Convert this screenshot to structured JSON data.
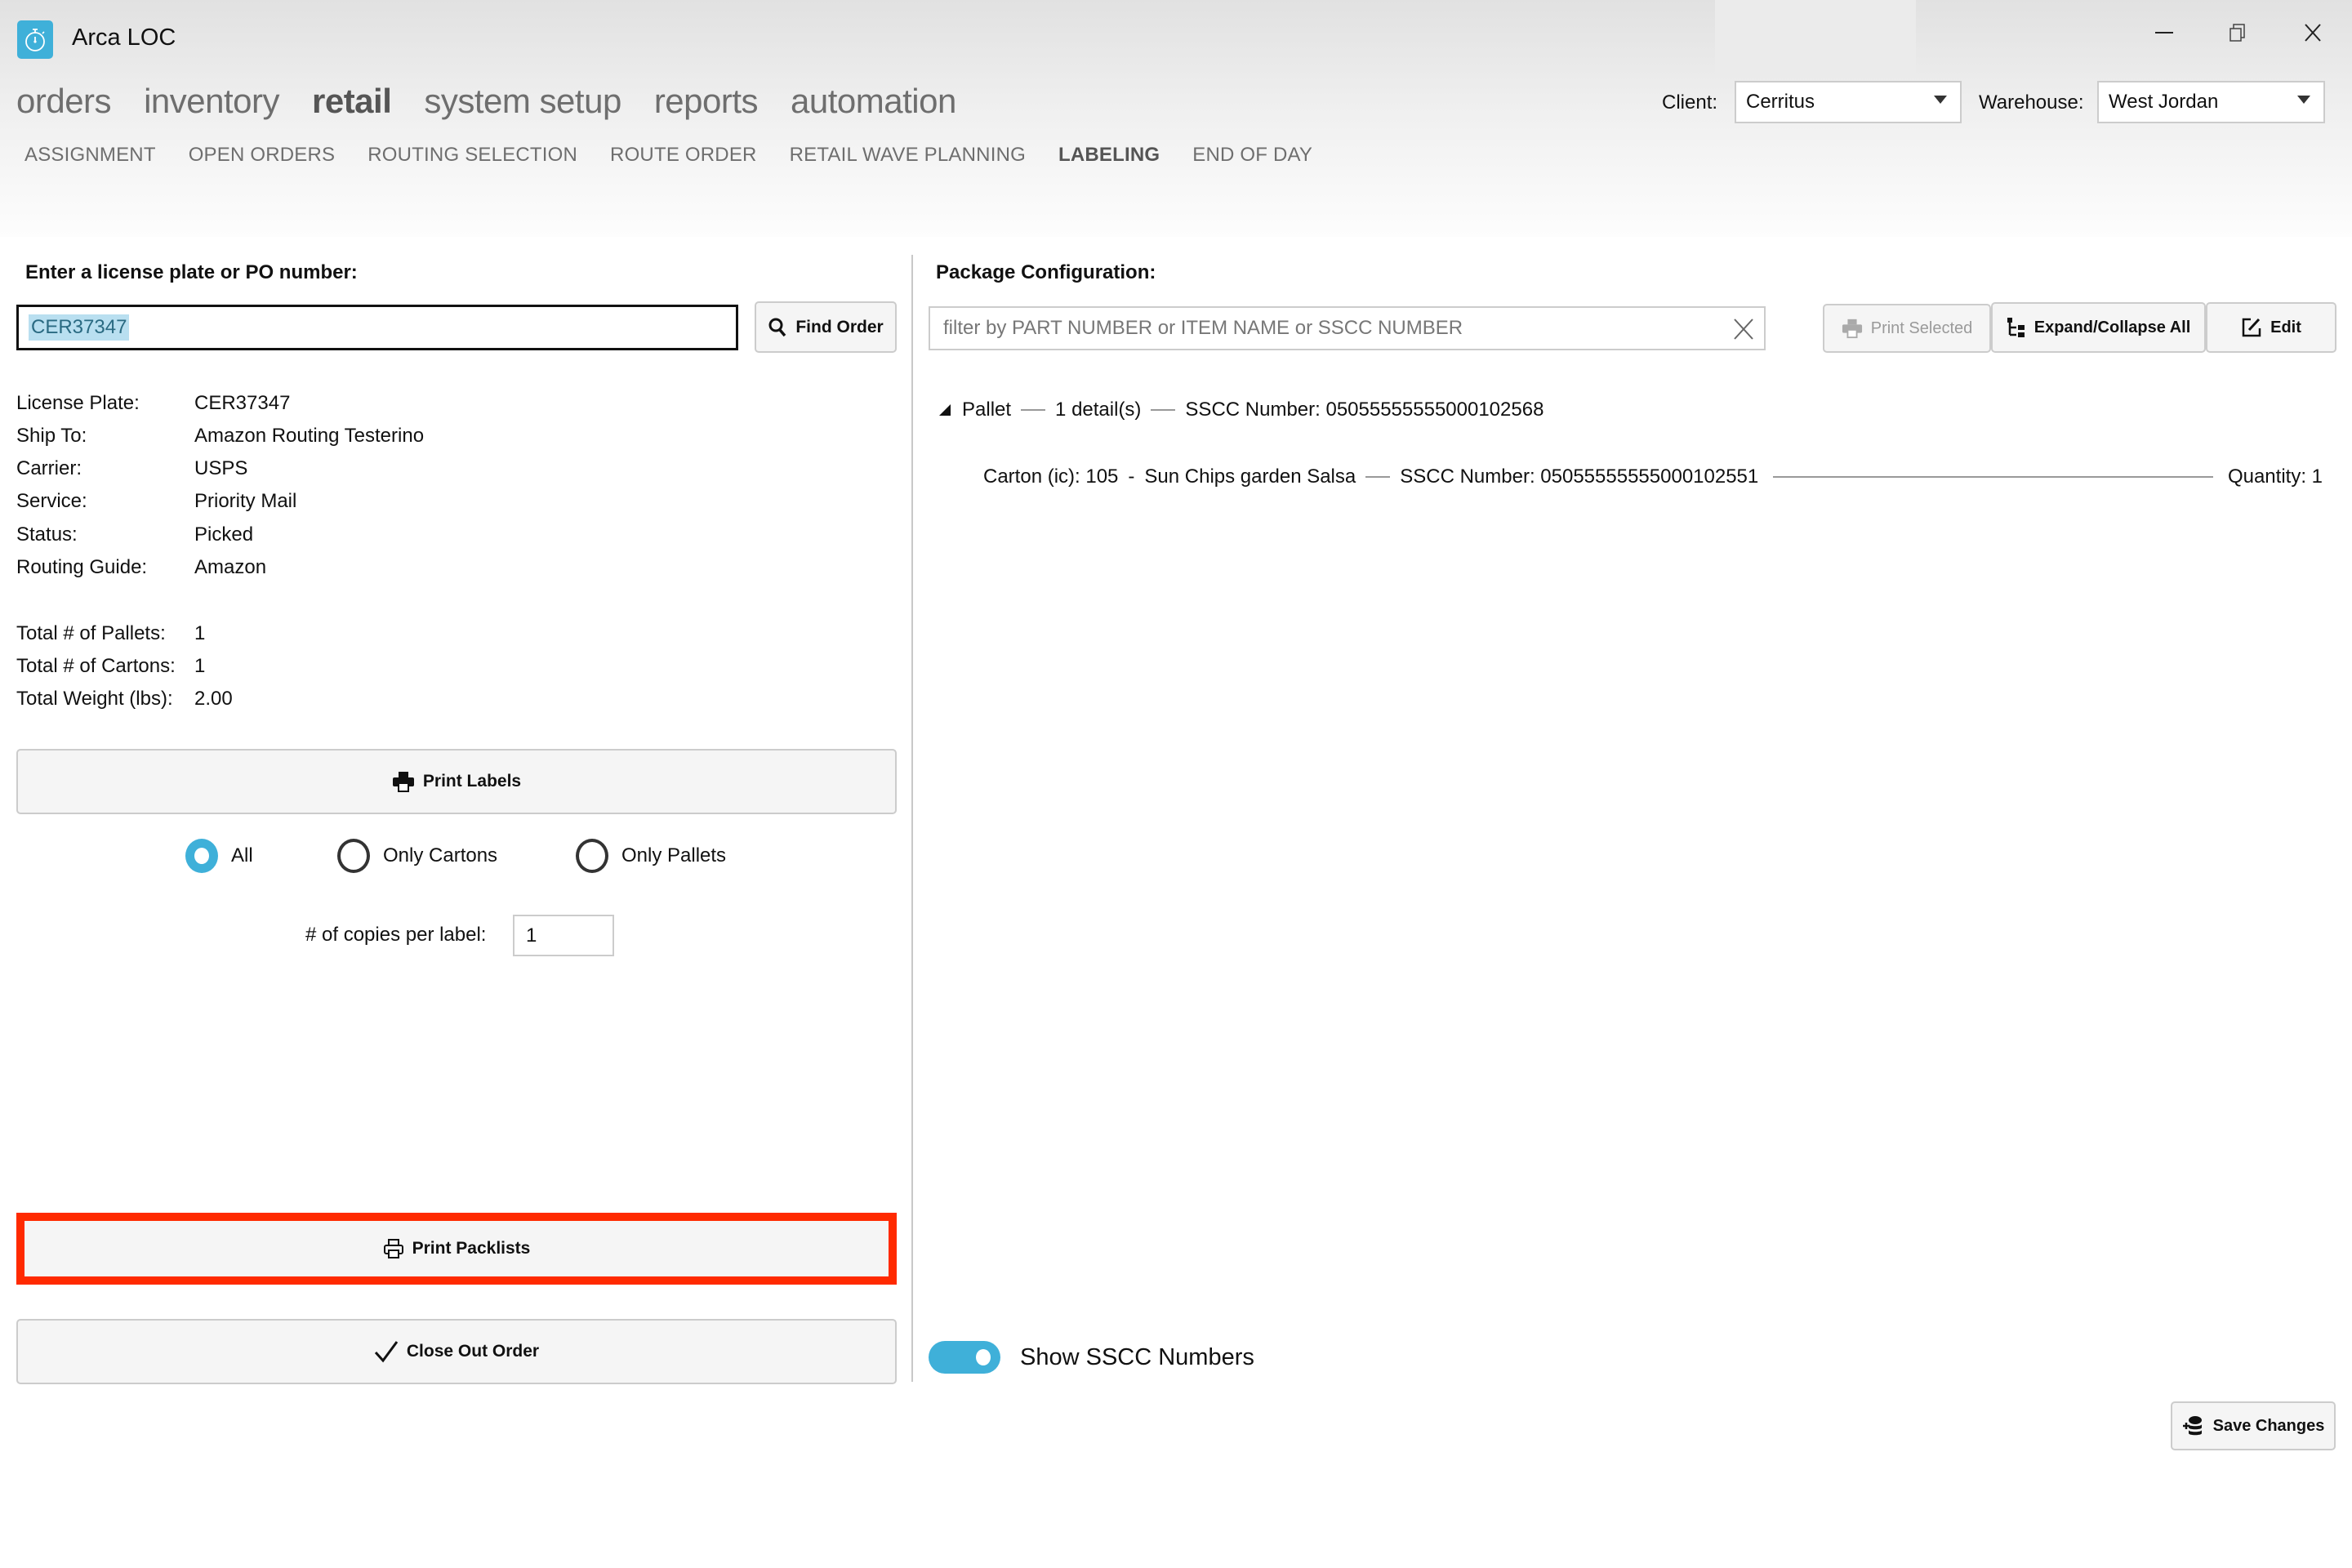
{
  "window": {
    "app_title": "Arca LOC",
    "icon": "stopwatch-icon",
    "controls": [
      "minimize-icon",
      "restore-icon",
      "close-icon"
    ]
  },
  "main_nav": {
    "items": [
      {
        "label": "orders",
        "active": false
      },
      {
        "label": "inventory",
        "active": false
      },
      {
        "label": "retail",
        "active": true
      },
      {
        "label": "system setup",
        "active": false
      },
      {
        "label": "reports",
        "active": false
      },
      {
        "label": "automation",
        "active": false
      }
    ]
  },
  "sub_nav": {
    "items": [
      {
        "label": "ASSIGNMENT",
        "active": false
      },
      {
        "label": "OPEN ORDERS",
        "active": false
      },
      {
        "label": "ROUTING SELECTION",
        "active": false
      },
      {
        "label": "ROUTE ORDER",
        "active": false
      },
      {
        "label": "RETAIL WAVE PLANNING",
        "active": false
      },
      {
        "label": "LABELING",
        "active": true
      },
      {
        "label": "END OF DAY",
        "active": false
      }
    ]
  },
  "filters": {
    "client_label": "Client:",
    "client_value": "Cerritus",
    "warehouse_label": "Warehouse:",
    "warehouse_value": "West Jordan"
  },
  "left": {
    "prompt": "Enter a license plate or PO number:",
    "search_value": "CER37347",
    "find_button": "Find Order",
    "details": [
      {
        "label": "License Plate:",
        "value": "CER37347"
      },
      {
        "label": "Ship To:",
        "value": "Amazon Routing Testerino"
      },
      {
        "label": "Carrier:",
        "value": "USPS"
      },
      {
        "label": "Service:",
        "value": "Priority Mail"
      },
      {
        "label": "Status:",
        "value": "Picked"
      },
      {
        "label": "Routing Guide:",
        "value": "Amazon"
      }
    ],
    "totals": [
      {
        "label": "Total # of Pallets:",
        "value": "1"
      },
      {
        "label": "Total # of Cartons:",
        "value": "1"
      },
      {
        "label": "Total Weight (lbs):",
        "value": "2.00"
      }
    ],
    "print_labels_button": "Print Labels",
    "label_scope": {
      "options": [
        "All",
        "Only Cartons",
        "Only Pallets"
      ],
      "selected": "All"
    },
    "copies_label": "# of copies per label:",
    "copies_value": "1",
    "print_packlists_button": "Print Packlists",
    "close_out_button": "Close Out Order",
    "highlight_color": "#ff2a00"
  },
  "right": {
    "title": "Package Configuration:",
    "filter_placeholder": "filter by PART NUMBER or ITEM NAME or SSCC NUMBER",
    "print_selected_button": "Print Selected",
    "expand_collapse_button": "Expand/Collapse All",
    "edit_button": "Edit",
    "tree": {
      "pallet": {
        "label": "Pallet",
        "details": "1 detail(s)",
        "sscc": "SSCC Number: 05055555555000102568",
        "expanded": true
      },
      "carton": {
        "label": "Carton (ic): 105",
        "separator": "-",
        "item": "Sun Chips garden Salsa",
        "sscc": "SSCC Number: 05055555555000102551",
        "quantity": "Quantity: 1"
      }
    },
    "show_sscc_label": "Show SSCC Numbers",
    "show_sscc_on": true,
    "save_button": "Save Changes"
  },
  "colors": {
    "accent": "#3fb0d9",
    "highlight": "#ff2a00",
    "nav_text": "#6e6e6e"
  }
}
